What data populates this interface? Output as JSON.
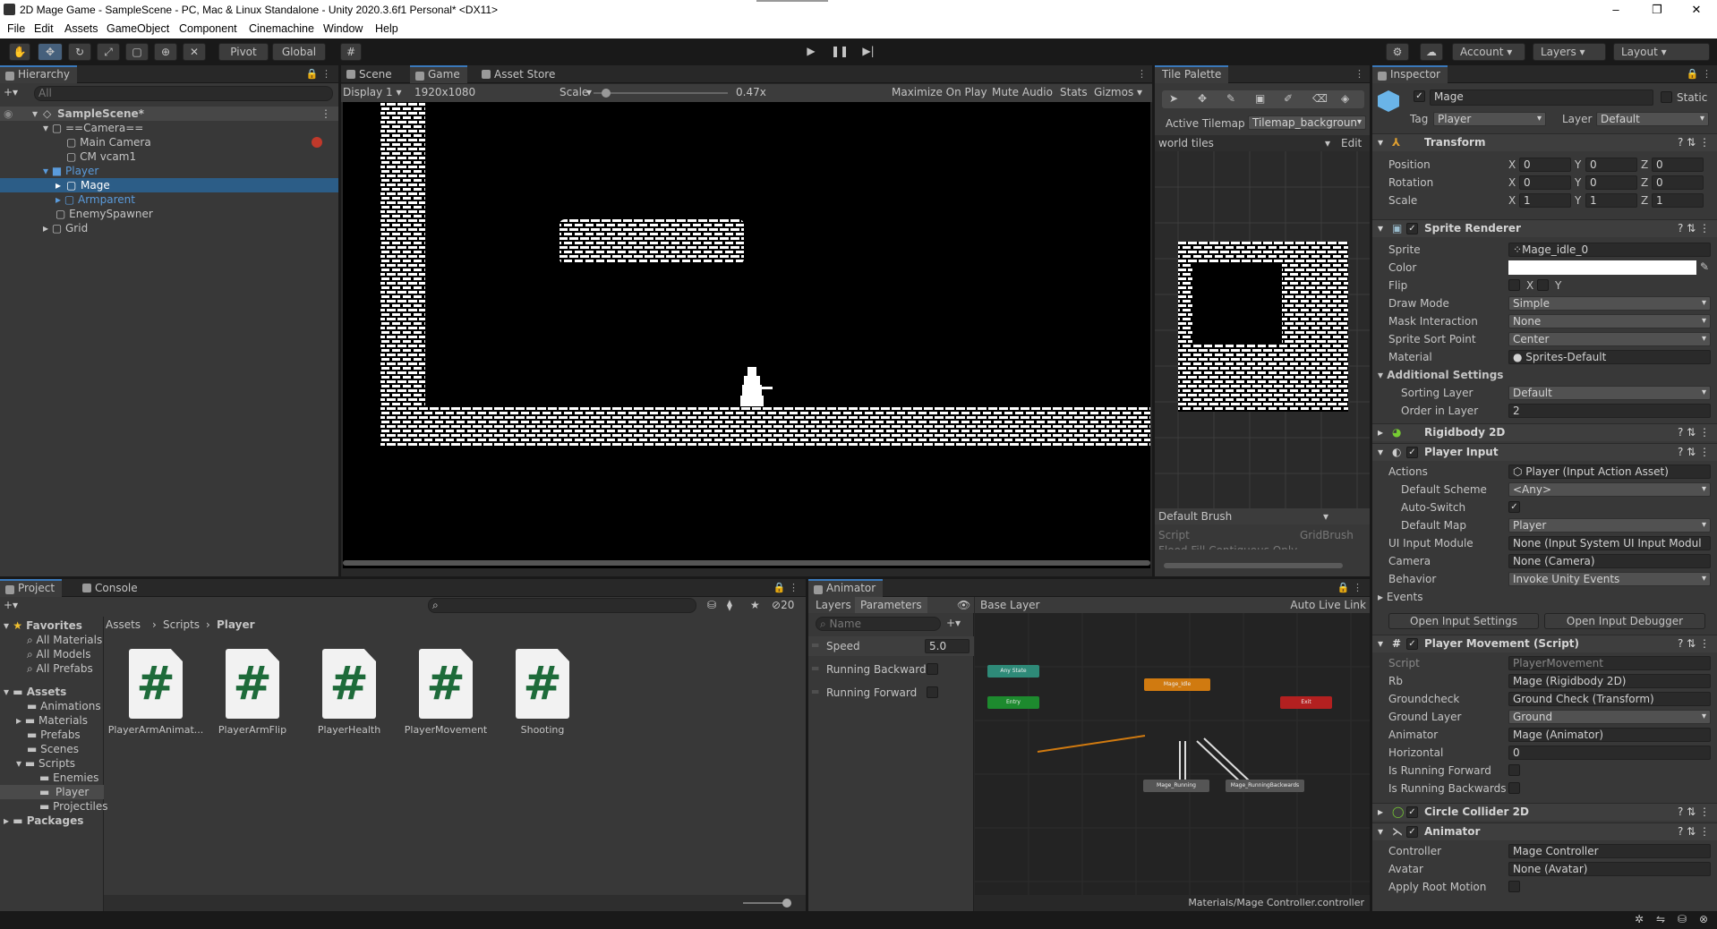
{
  "window": {
    "title": "2D Mage Game - SampleScene - PC, Mac & Linux Standalone - Unity 2020.3.6f1 Personal* <DX11>"
  },
  "menu": [
    "File",
    "Edit",
    "Assets",
    "GameObject",
    "Component",
    "Cinemachine",
    "Window",
    "Help"
  ],
  "toolbar": {
    "pivot": "Pivot",
    "global": "Global",
    "account": "Account",
    "layers": "Layers",
    "layout": "Layout"
  },
  "hierarchy": {
    "tab": "Hierarchy",
    "search_placeholder": "All",
    "scene": "SampleScene*",
    "items": [
      "==Camera==",
      "Main Camera",
      "CM vcam1",
      "Player",
      "Mage",
      "Armparent",
      "EnemySpawner",
      "Grid"
    ]
  },
  "sceneview": {
    "tabs": [
      "Scene",
      "Game",
      "Asset Store"
    ],
    "display": "Display 1",
    "resolution": "1920x1080",
    "scale_label": "Scale",
    "scale_value": "0.47x",
    "scale_fraction": 0.09,
    "buttons": [
      "Maximize On Play",
      "Mute Audio",
      "Stats",
      "Gizmos"
    ]
  },
  "tilepalette": {
    "tab": "Tile Palette",
    "active_tilemap_label": "Active Tilemap",
    "active_tilemap": "Tilemap_backgroun",
    "palette": "world tiles",
    "edit": "Edit",
    "brush": "Default Brush",
    "script_label": "Script",
    "script_value": "GridBrush",
    "flood": "Flood Fill Contiguous Only"
  },
  "inspector": {
    "tab": "Inspector",
    "object_name": "Mage",
    "static_label": "Static",
    "tag_label": "Tag",
    "tag": "Player",
    "layer_label": "Layer",
    "layer": "Default",
    "transform": {
      "title": "Transform",
      "rows": [
        {
          "label": "Position",
          "x": "0",
          "y": "0",
          "z": "0"
        },
        {
          "label": "Rotation",
          "x": "0",
          "y": "0",
          "z": "0"
        },
        {
          "label": "Scale",
          "x": "1",
          "y": "1",
          "z": "1"
        }
      ]
    },
    "sprite_renderer": {
      "title": "Sprite Renderer",
      "sprite_label": "Sprite",
      "sprite": "Mage_idle_0",
      "color_label": "Color",
      "flip_label": "Flip",
      "flip_x": "X",
      "flip_y": "Y",
      "draw_mode_label": "Draw Mode",
      "draw_mode": "Simple",
      "mask_label": "Mask Interaction",
      "mask": "None",
      "sort_point_label": "Sprite Sort Point",
      "sort_point": "Center",
      "material_label": "Material",
      "material": "Sprites-Default",
      "additional": "Additional Settings",
      "sorting_layer_label": "Sorting Layer",
      "sorting_layer": "Default",
      "order_label": "Order in Layer",
      "order": "2"
    },
    "rigidbody": {
      "title": "Rigidbody 2D"
    },
    "player_input": {
      "title": "Player Input",
      "actions_label": "Actions",
      "actions": "Player (Input Action Asset)",
      "scheme_label": "Default Scheme",
      "scheme": "<Any>",
      "autoswitch_label": "Auto-Switch",
      "map_label": "Default Map",
      "map": "Player",
      "ui_label": "UI Input Module",
      "ui": "None (Input System UI Input Modul",
      "camera_label": "Camera",
      "camera": "None (Camera)",
      "behavior_label": "Behavior",
      "behavior": "Invoke Unity Events",
      "events_label": "Events",
      "open_settings": "Open Input Settings",
      "open_debugger": "Open Input Debugger"
    },
    "player_movement": {
      "title": "Player Movement (Script)",
      "script_label": "Script",
      "script": "PlayerMovement",
      "rb_label": "Rb",
      "rb": "Mage (Rigidbody 2D)",
      "groundcheck_label": "Groundcheck",
      "groundcheck": "Ground Check (Transform)",
      "ground_layer_label": "Ground Layer",
      "ground_layer": "Ground",
      "animator_label": "Animator",
      "animator": "Mage (Animator)",
      "horizontal_label": "Horizontal",
      "horizontal": "0",
      "running_fwd_label": "Is Running Forward",
      "running_back_label": "Is Running Backwards"
    },
    "circle_collider": {
      "title": "Circle Collider 2D"
    },
    "animator": {
      "title": "Animator",
      "controller_label": "Controller",
      "controller": "Mage Controller",
      "avatar_label": "Avatar",
      "avatar": "None (Avatar)",
      "root_motion_label": "Apply Root Motion"
    }
  },
  "project": {
    "tabs": [
      "Project",
      "Console"
    ],
    "count": "20",
    "breadcrumb": [
      "Assets",
      "Scripts",
      "Player"
    ],
    "favorites": "Favorites",
    "fav_items": [
      "All Materials",
      "All Models",
      "All Prefabs"
    ],
    "assets": "Assets",
    "asset_items": [
      "Animations",
      "Materials",
      "Prefabs",
      "Scenes",
      "Scripts"
    ],
    "script_items": [
      "Enemies",
      "Player",
      "Projectiles"
    ],
    "packages": "Packages",
    "files": [
      "PlayerArmAnimat...",
      "PlayerArmFlip",
      "PlayerHealth",
      "PlayerMovement",
      "Shooting"
    ]
  },
  "animator_panel": {
    "tab": "Animator",
    "layers": "Layers",
    "parameters": "Parameters",
    "name_placeholder": "Name",
    "base_layer": "Base Layer",
    "auto_live": "Auto Live Link",
    "speed_label": "Speed",
    "speed": "5.0",
    "running_back": "Running Backward",
    "running_fwd": "Running Forward",
    "states": {
      "any": "Any State",
      "entry": "Entry",
      "idle": "Mage_Idle",
      "exit": "Exit",
      "running": "Mage_Running",
      "running_back": "Mage_RunningBackwards"
    },
    "footer": "Materials/Mage Controller.controller"
  },
  "colors": {
    "accent": "#3a79bb",
    "selection": "#2c5d87",
    "panel": "#383838",
    "dark": "#282828"
  }
}
